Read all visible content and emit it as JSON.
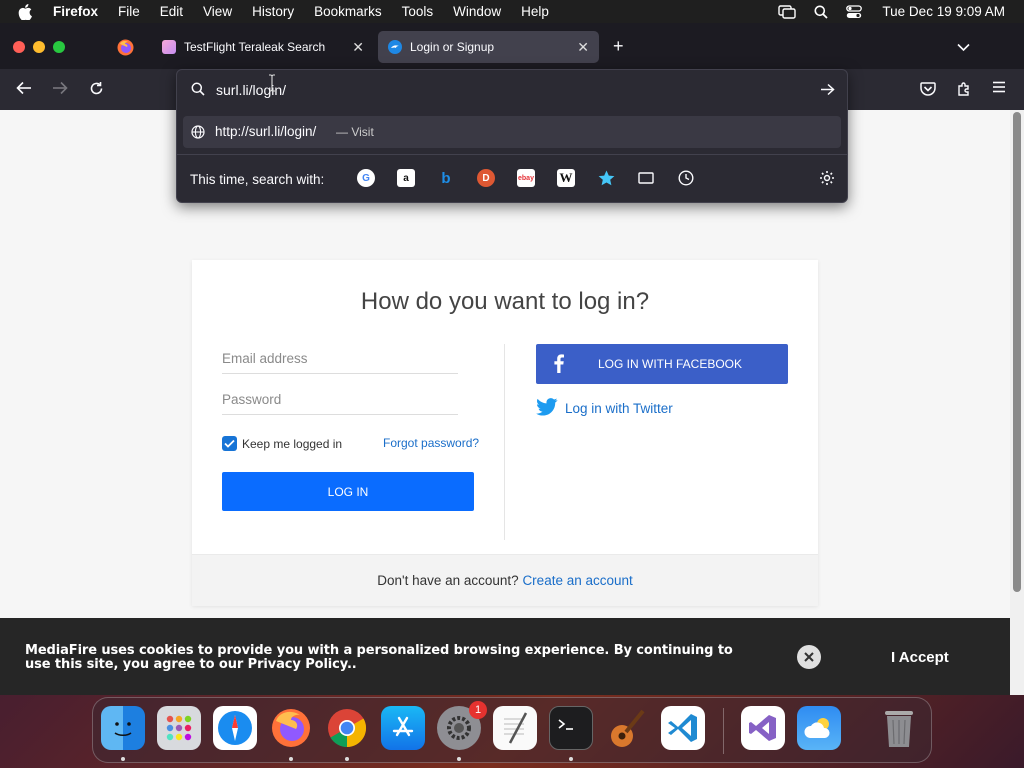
{
  "menubar": {
    "app_name": "Firefox",
    "items": [
      "File",
      "Edit",
      "View",
      "History",
      "Bookmarks",
      "Tools",
      "Window",
      "Help"
    ],
    "clock": "Tue Dec 19  9:09 AM"
  },
  "tabs": [
    {
      "title": "TestFlight Teraleak Search"
    },
    {
      "title": "Login or Signup"
    }
  ],
  "urlbar": {
    "value": "surl.li/login/",
    "suggestion_url": "http://surl.li/login/",
    "suggestion_action": "— Visit",
    "search_with_label": "This time, search with:"
  },
  "login_card": {
    "title": "How do you want to log in?",
    "email_placeholder": "Email address",
    "password_placeholder": "Password",
    "keep_logged_in": "Keep me logged in",
    "keep_logged_in_checked": true,
    "forgot_password": "Forgot password?",
    "login_button": "LOG IN",
    "facebook_button": "LOG IN WITH FACEBOOK",
    "twitter_link": "Log in with Twitter",
    "footer_text": "Don't have an account?",
    "create_account": "Create an account"
  },
  "cookie_banner": {
    "message": "MediaFire uses cookies to provide you with a personalized browsing experience. By continuing to use this site, you agree to our Privacy Policy..",
    "accept": "I Accept"
  },
  "dock": {
    "apps": [
      "Finder",
      "Launchpad",
      "Safari",
      "Firefox",
      "Chrome",
      "App Store",
      "System Settings",
      "TextEdit",
      "Terminal",
      "GarageBand",
      "Visual Studio Code",
      "Visual Studio",
      "Weather",
      "Trash"
    ],
    "system_settings_badge": "1"
  },
  "colors": {
    "accent_blue": "#0a6cff",
    "facebook_blue": "#3b5fc8",
    "link_blue": "#1a6ec9",
    "chrome_dark": "#2b2a33"
  }
}
